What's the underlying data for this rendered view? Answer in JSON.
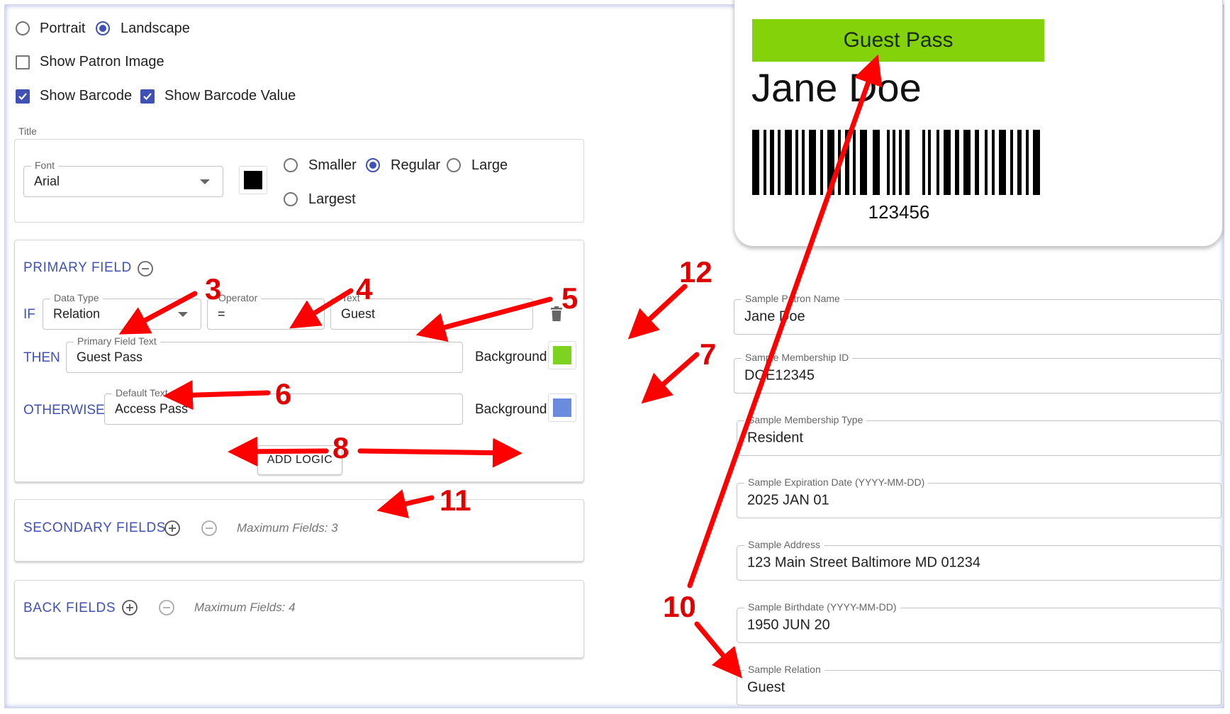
{
  "orientation": {
    "options": [
      "Portrait",
      "Landscape"
    ],
    "selected": "Landscape"
  },
  "toggles": {
    "show_patron_image": {
      "label": "Show Patron Image",
      "checked": false
    },
    "show_barcode": {
      "label": "Show Barcode",
      "checked": true
    },
    "show_barcode_value": {
      "label": "Show Barcode Value",
      "checked": true
    }
  },
  "title_section": {
    "heading": "Title",
    "font_label": "Font",
    "font_value": "Arial",
    "color": "#000000",
    "sizes": [
      "Smaller",
      "Regular",
      "Large",
      "Largest"
    ],
    "selected_size": "Regular"
  },
  "primary": {
    "heading": "PRIMARY FIELD",
    "if_label": "IF",
    "then_label": "THEN",
    "otherwise_label": "OTHERWISE",
    "data_type_label": "Data Type",
    "data_type_value": "Relation",
    "operator_label": "Operator",
    "operator_value": "=",
    "text_label": "Text",
    "text_value": "Guest",
    "primary_text_label": "Primary Field Text",
    "primary_text_value": "Guest Pass",
    "background_label": "Background",
    "then_color": "#7ed321",
    "default_text_label": "Default Text",
    "default_text_value": "Access Pass",
    "otherwise_color": "#6b8cde",
    "add_logic": "ADD LOGIC"
  },
  "secondary": {
    "heading": "SECONDARY FIELDS",
    "max": "Maximum Fields: 3"
  },
  "back": {
    "heading": "BACK FIELDS",
    "max": "Maximum Fields: 4"
  },
  "preview": {
    "header_text": "Guest Pass",
    "header_color": "#84d30a",
    "name": "Jane Doe",
    "barcode_value": "123456"
  },
  "samples": [
    {
      "label": "Sample Patron Name",
      "value": "Jane Doe"
    },
    {
      "label": "Sample Membership ID",
      "value": "DOE12345"
    },
    {
      "label": "Sample Membership Type",
      "value": "Resident"
    },
    {
      "label": "Sample Expiration Date (YYYY-MM-DD)",
      "value": "2025 JAN 01"
    },
    {
      "label": "Sample Address",
      "value": "123 Main Street Baltimore MD 01234"
    },
    {
      "label": "Sample Birthdate (YYYY-MM-DD)",
      "value": "1950 JUN 20"
    },
    {
      "label": "Sample Relation",
      "value": "Guest"
    }
  ],
  "annotations": {
    "a3": "3",
    "a4": "4",
    "a5": "5",
    "a6": "6",
    "a7": "7",
    "a8": "8",
    "a10": "10",
    "a11": "11",
    "a12": "12"
  }
}
